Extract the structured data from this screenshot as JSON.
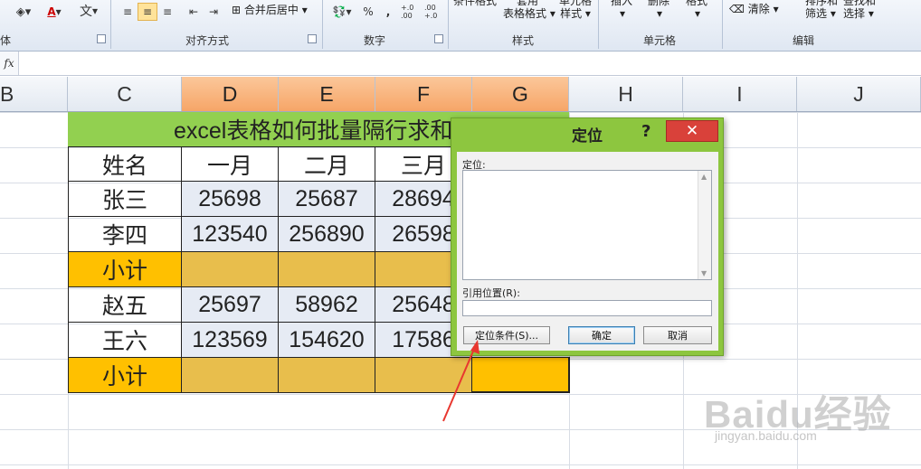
{
  "ribbon": {
    "groups": [
      {
        "label": "体",
        "launcher": true
      },
      {
        "label": "对齐方式",
        "launcher": true
      },
      {
        "label": "数字",
        "launcher": true
      },
      {
        "label": "样式"
      },
      {
        "label": "单元格"
      },
      {
        "label": "编辑"
      }
    ],
    "merge_center": "合并后居中",
    "cond_format": "条件格式",
    "table_format_1": "套用",
    "table_format_2": "表格格式",
    "cell_style_1": "单元格",
    "cell_style_2": "样式",
    "insert": "插入",
    "delete": "删除",
    "format": "格式",
    "clear": "清除",
    "sort_1": "排序和",
    "sort_2": "筛选",
    "find_1": "查找和",
    "find_2": "选择",
    "percent": "%",
    "comma": ",",
    "inc_dec": "+.0 .00",
    "dec_dec": ".00 +.0",
    "wen": "文",
    "font_a": "A"
  },
  "formula_bar": {
    "fx": "fx",
    "value": ""
  },
  "columns": [
    "B",
    "C",
    "D",
    "E",
    "F",
    "G",
    "H",
    "I",
    "J"
  ],
  "sheet": {
    "title": "excel表格如何批量隔行求和",
    "header_row": [
      "姓名",
      "一月",
      "二月",
      "三月"
    ],
    "rows": [
      {
        "name": "张三",
        "values": [
          "25698",
          "25687",
          "28694"
        ],
        "type": "data"
      },
      {
        "name": "李四",
        "values": [
          "123540",
          "256890",
          "26598"
        ],
        "type": "data"
      },
      {
        "name": "小计",
        "values": [
          "",
          "",
          ""
        ],
        "type": "subtotal"
      },
      {
        "name": "赵五",
        "values": [
          "25697",
          "58962",
          "25648"
        ],
        "type": "data"
      },
      {
        "name": "王六",
        "values": [
          "123569",
          "154620",
          "17586"
        ],
        "type": "data"
      },
      {
        "name": "小计",
        "values": [
          "",
          "",
          ""
        ],
        "type": "subtotal"
      }
    ]
  },
  "dialog": {
    "title": "定位",
    "help": "?",
    "close": "✕",
    "goto_label": "定位:",
    "reference_label": "引用位置(R):",
    "special_button": "定位条件(S)...",
    "ok_button": "确定",
    "cancel_button": "取消"
  },
  "watermark": {
    "logo": "Baidu经验",
    "url": "jingyan.baidu.com"
  },
  "colors": {
    "title_bg": "#92d050",
    "subtotal": "#ffc000",
    "selected_col": "#f6a567",
    "dialog_frame": "#8dc63f",
    "arrow": "#e8372f"
  }
}
